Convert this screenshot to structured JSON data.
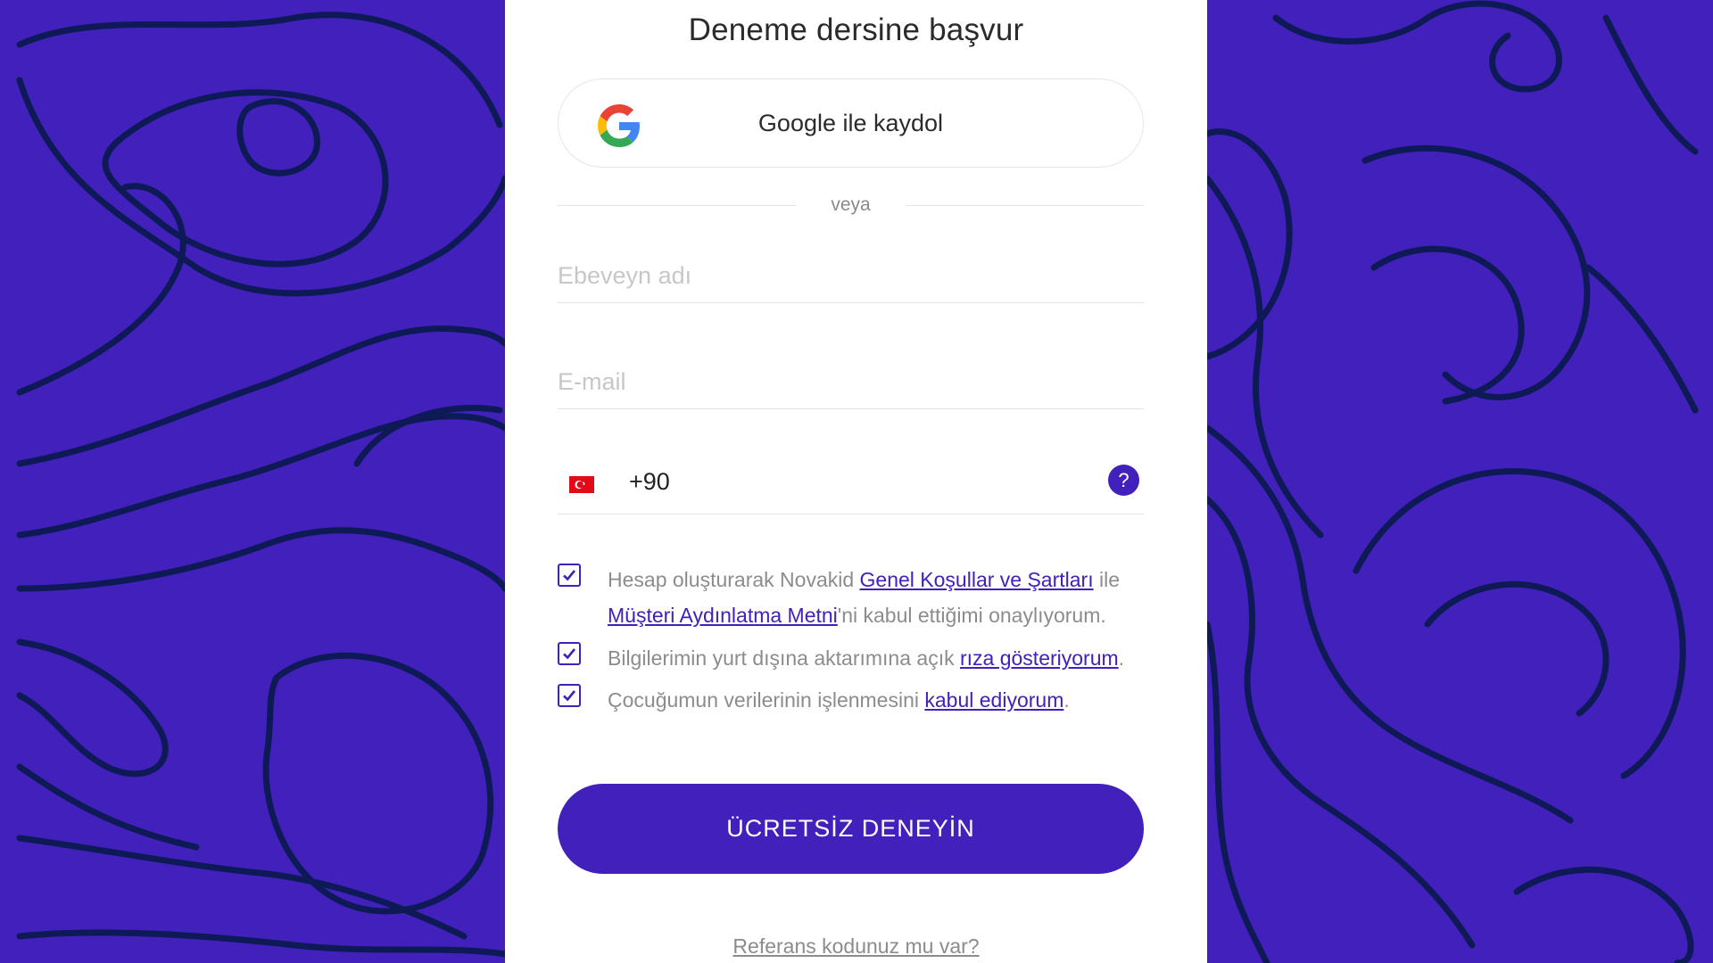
{
  "form": {
    "title": "Deneme dersine başvur",
    "google_button_label": "Google ile kaydol",
    "divider_text": "veya",
    "parent_name_placeholder": "Ebeveyn adı",
    "email_placeholder": "E-mail",
    "phone_country_code": "+90",
    "phone_help_icon": "?",
    "consent_1": {
      "prefix": "Hesap oluşturarak Novakid ",
      "link1": "Genel Koşullar ve Şartları",
      "middle": " ile",
      "link2": "Müşteri Aydınlatma Metni",
      "suffix": "'ni kabul ettiğimi onaylıyorum.",
      "checked": true
    },
    "consent_2": {
      "prefix": "Bilgilerimin yurt dışına aktarımına açık ",
      "link": "rıza gösteriyorum",
      "suffix": ".",
      "checked": true
    },
    "consent_3": {
      "prefix": "Çocuğumun verilerinin işlenmesini ",
      "link": "kabul ediyorum",
      "suffix": ".",
      "checked": true
    },
    "submit_label": "ÜCRETSİZ DENEYİN",
    "referral_link": "Referans kodunuz mu var?"
  },
  "icons": {
    "google": "google-logo-icon",
    "flag": "turkey-flag-icon",
    "help": "question-mark-icon",
    "checkbox": "checkmark-icon"
  },
  "colors": {
    "brand": "#4220bb",
    "background_lines": "#0e1a55",
    "panel": "#ffffff",
    "muted_text": "#8c8c8c"
  }
}
